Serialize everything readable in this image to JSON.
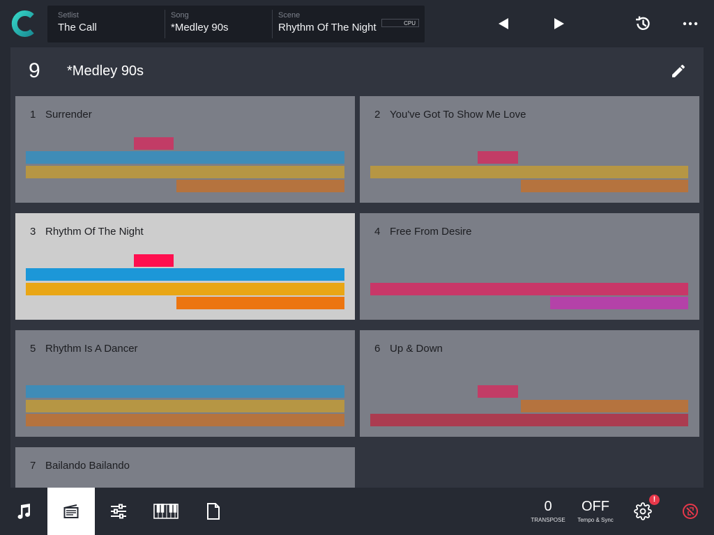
{
  "topbar": {
    "setlist_label": "Setlist",
    "setlist_value": "The Call",
    "song_label": "Song",
    "song_value": "*Medley 90s",
    "scene_label": "Scene",
    "scene_value": "Rhythm Of The Night",
    "cpu_label": "CPU",
    "icons": [
      "prev-scene-icon",
      "next-scene-icon",
      "history-icon",
      "more-icon"
    ]
  },
  "song": {
    "number": "9",
    "title": "*Medley 90s"
  },
  "scenes": [
    {
      "num": "1",
      "name": "Surrender",
      "active": false
    },
    {
      "num": "2",
      "name": "You've Got To Show Me Love",
      "active": false
    },
    {
      "num": "3",
      "name": "Rhythm Of The Night",
      "active": true
    },
    {
      "num": "4",
      "name": "Free From Desire",
      "active": false
    },
    {
      "num": "5",
      "name": "Rhythm Is A Dancer",
      "active": false
    },
    {
      "num": "6",
      "name": "Up & Down",
      "active": false
    },
    {
      "num": "7",
      "name": "Bailando Bailando",
      "active": false
    }
  ],
  "colors": {
    "red": "#ff0f4f",
    "blue": "#1c97d8",
    "yellow": "#e9a615",
    "orange": "#ec7510",
    "pink": "#c83768",
    "purple": "#b442a8",
    "crimson": "#ab3c50",
    "dim_red": "#c23c66",
    "dim_blue": "#3f8cb7",
    "dim_yellow": "#b69644",
    "dim_orange": "#b5733e"
  },
  "bottombar": {
    "transpose_value": "0",
    "transpose_label": "TRANSPOSE",
    "tempo_value": "OFF",
    "tempo_label": "Tempo & Sync",
    "badge": "!",
    "icons": [
      "songs-icon",
      "scenes-icon",
      "mixer-icon",
      "keyboard-icon",
      "document-icon",
      "settings-icon",
      "panic-icon"
    ]
  }
}
